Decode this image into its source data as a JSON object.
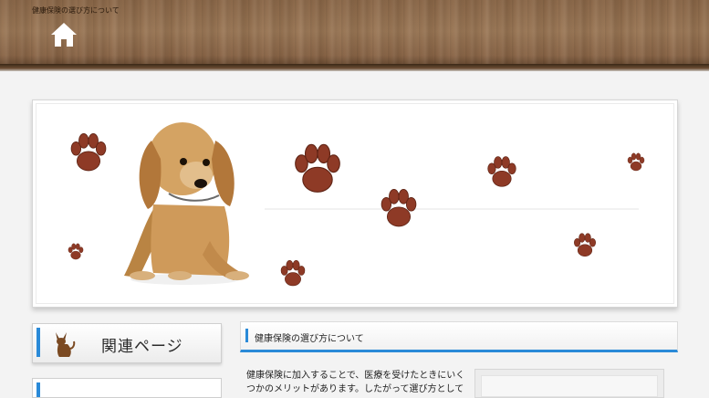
{
  "site": {
    "title": "健康保険の選び方について",
    "home_icon": "home-icon"
  },
  "hero": {
    "image": "puppy-with-paw-prints-banner",
    "paw_color": "#8e3a26"
  },
  "sidebar": {
    "related_title": "関連ページ",
    "accent_color": "#2a8ad8"
  },
  "article": {
    "title": "健康保険の選び方について",
    "body": "健康保険に加入することで、医療を受けたときにいくつかのメリットがあります。したがって選び方として"
  }
}
